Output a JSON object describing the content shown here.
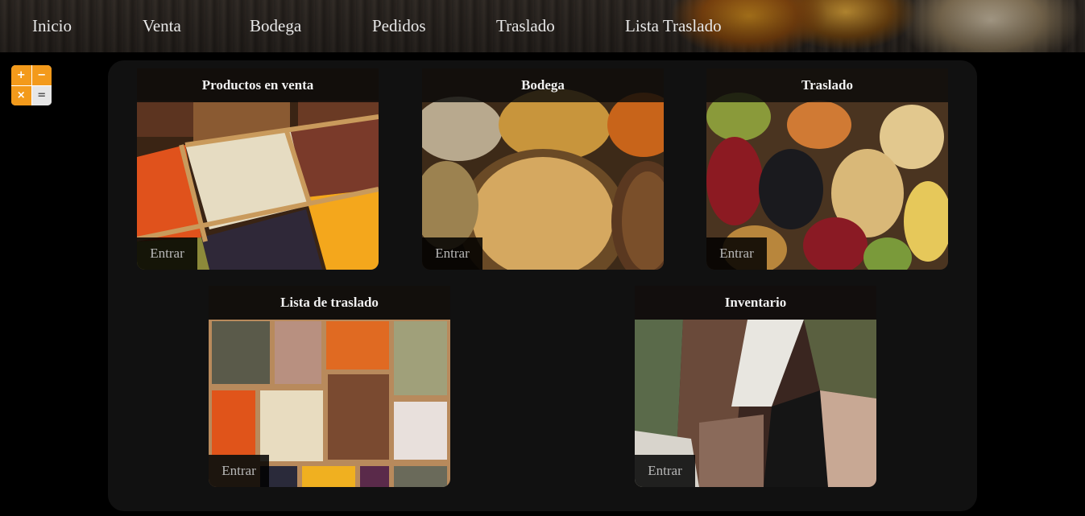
{
  "nav": {
    "items": [
      "Inicio",
      "Venta",
      "Bodega",
      "Pedidos",
      "Traslado",
      "Lista Traslado"
    ]
  },
  "calculator": {
    "keys": [
      "+",
      "−",
      "×",
      "="
    ],
    "icon": "calculator-icon"
  },
  "cards": [
    {
      "title": "Productos en venta",
      "button": "Entrar"
    },
    {
      "title": "Bodega",
      "button": "Entrar"
    },
    {
      "title": "Traslado",
      "button": "Entrar"
    },
    {
      "title": "Lista de traslado",
      "button": "Entrar"
    },
    {
      "title": "Inventario",
      "button": "Entrar"
    }
  ],
  "colors": {
    "background": "#000000",
    "panel": "#111111",
    "calc_orange": "#f39a1b"
  }
}
